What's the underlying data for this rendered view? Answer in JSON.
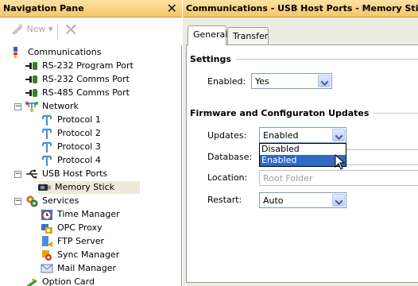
{
  "nav": {
    "title": "Navigation Pane",
    "toolbar": {
      "new_label": "New",
      "new_caret": "▾"
    },
    "items": [
      {
        "label": "Communications",
        "icon": "communications-icon"
      },
      {
        "label": "RS-232 Program Port",
        "icon": "serial-port-icon"
      },
      {
        "label": "RS-232 Comms Port",
        "icon": "serial-port-icon"
      },
      {
        "label": "RS-485 Comms Port",
        "icon": "serial-port-icon"
      },
      {
        "label": "Network",
        "icon": "network-icon",
        "expander": "−"
      },
      {
        "label": "Protocol 1",
        "icon": "protocol-icon"
      },
      {
        "label": "Protocol 2",
        "icon": "protocol-icon"
      },
      {
        "label": "Protocol 3",
        "icon": "protocol-icon"
      },
      {
        "label": "Protocol 4",
        "icon": "protocol-icon"
      },
      {
        "label": "USB Host Ports",
        "icon": "usb-icon",
        "expander": "−"
      },
      {
        "label": "Memory Stick",
        "icon": "memory-stick-icon",
        "selected": true
      },
      {
        "label": "Services",
        "icon": "services-icon",
        "expander": "−"
      },
      {
        "label": "Time Manager",
        "icon": "clock-icon"
      },
      {
        "label": "OPC Proxy",
        "icon": "opc-icon"
      },
      {
        "label": "FTP Server",
        "icon": "ftp-icon"
      },
      {
        "label": "Sync Manager",
        "icon": "sync-icon"
      },
      {
        "label": "Mail Manager",
        "icon": "mail-icon"
      },
      {
        "label": "Option Card",
        "icon": "option-card-icon"
      }
    ]
  },
  "content": {
    "title": "Communications - USB Host Ports - Memory Stick",
    "tabs": [
      "General",
      "Transfer"
    ],
    "settings": {
      "title": "Settings",
      "enabled_label": "Enabled:",
      "enabled_value": "Yes"
    },
    "firmware": {
      "title": "Firmware and Configuraton Updates",
      "updates_label": "Updates:",
      "updates_value": "Enabled",
      "database_label": "Database:",
      "location_label": "Location:",
      "location_value": "Root Folder",
      "restart_label": "Restart:",
      "restart_value": "Auto"
    },
    "dropdown_options": [
      "Disabled",
      "Enabled"
    ]
  },
  "colors": {
    "header_gradient_top": "#fbe3a3",
    "header_gradient_bottom": "#f4c567",
    "selection": "#316ac5"
  }
}
